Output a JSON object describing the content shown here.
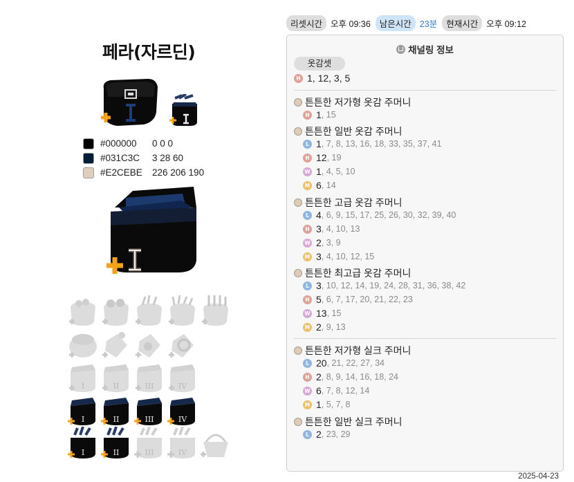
{
  "page_title": "페라(자르딘)",
  "palette": [
    {
      "hex_label": "#000000",
      "rgb_label": "0 0 0",
      "color": "#000000"
    },
    {
      "hex_label": "#031C3C",
      "rgb_label": "3 28 60",
      "color": "#031C3C"
    },
    {
      "hex_label": "#E2CEBE",
      "rgb_label": "226 206 190",
      "color": "#E2CEBE"
    }
  ],
  "topbar": {
    "reset_label": "리셋시간",
    "reset_value": "오후 09:36",
    "remain_label": "남은시간",
    "remain_value": "23분",
    "now_label": "현재시간",
    "now_value": "오후 09:12"
  },
  "panel": {
    "title": "채널링 정보",
    "tag": "옷감셋",
    "summary": {
      "first": "1",
      "rest": ", 12, 3, 5"
    }
  },
  "pouches": [
    {
      "name": "튼튼한 저가형 옷감 주머니",
      "rows": [
        {
          "badge": "H",
          "first": "1",
          "rest": ", 15"
        }
      ]
    },
    {
      "name": "튼튼한 일반 옷감 주머니",
      "rows": [
        {
          "badge": "L",
          "first": "1",
          "rest": ", 7, 8, 13, 16, 18, 33, 35, 37, 41"
        },
        {
          "badge": "H",
          "first": "12",
          "rest": ", 19"
        },
        {
          "badge": "W",
          "first": "1",
          "rest": ", 4, 5, 10"
        },
        {
          "badge": "M",
          "first": "6",
          "rest": ", 14"
        }
      ]
    },
    {
      "name": "튼튼한 고급 옷감 주머니",
      "rows": [
        {
          "badge": "L",
          "first": "4",
          "rest": ", 6, 9, 15, 17, 25, 26, 30, 32, 39, 40"
        },
        {
          "badge": "H",
          "first": "3",
          "rest": ", 4, 10, 13"
        },
        {
          "badge": "W",
          "first": "2",
          "rest": ", 3, 9"
        },
        {
          "badge": "M",
          "first": "3",
          "rest": ", 4, 10, 12, 15"
        }
      ]
    },
    {
      "name": "튼튼한 최고급 옷감 주머니",
      "rows": [
        {
          "badge": "L",
          "first": "3",
          "rest": ", 10, 12, 14, 19, 24, 28, 31, 36, 38, 42"
        },
        {
          "badge": "H",
          "first": "5",
          "rest": ", 6, 7, 17, 20, 21, 22, 23"
        },
        {
          "badge": "W",
          "first": "13",
          "rest": ", 15"
        },
        {
          "badge": "M",
          "first": "2",
          "rest": ", 9, 13"
        }
      ]
    },
    {
      "name": "튼튼한 저가형 실크 주머니",
      "rows": [
        {
          "badge": "L",
          "first": "20",
          "rest": ", 21, 22, 27, 34"
        },
        {
          "badge": "H",
          "first": "2",
          "rest": ", 8, 9, 14, 16, 18, 24"
        },
        {
          "badge": "W",
          "first": "6",
          "rest": ", 7, 8, 12, 14"
        },
        {
          "badge": "M",
          "first": "1",
          "rest": ", 5, 7, 8"
        }
      ]
    },
    {
      "name": "튼튼한 일반 실크 주머니",
      "rows": [
        {
          "badge": "L",
          "first": "2",
          "rest": ", 23, 29"
        }
      ]
    }
  ],
  "badge_colors": {
    "H": "#e0a096",
    "L": "#8fb7e2",
    "W": "#d7a8d6",
    "M": "#ecc06a"
  },
  "tier_numerals": [
    "I",
    "II",
    "III",
    "IV"
  ],
  "date": "2025-04-23"
}
